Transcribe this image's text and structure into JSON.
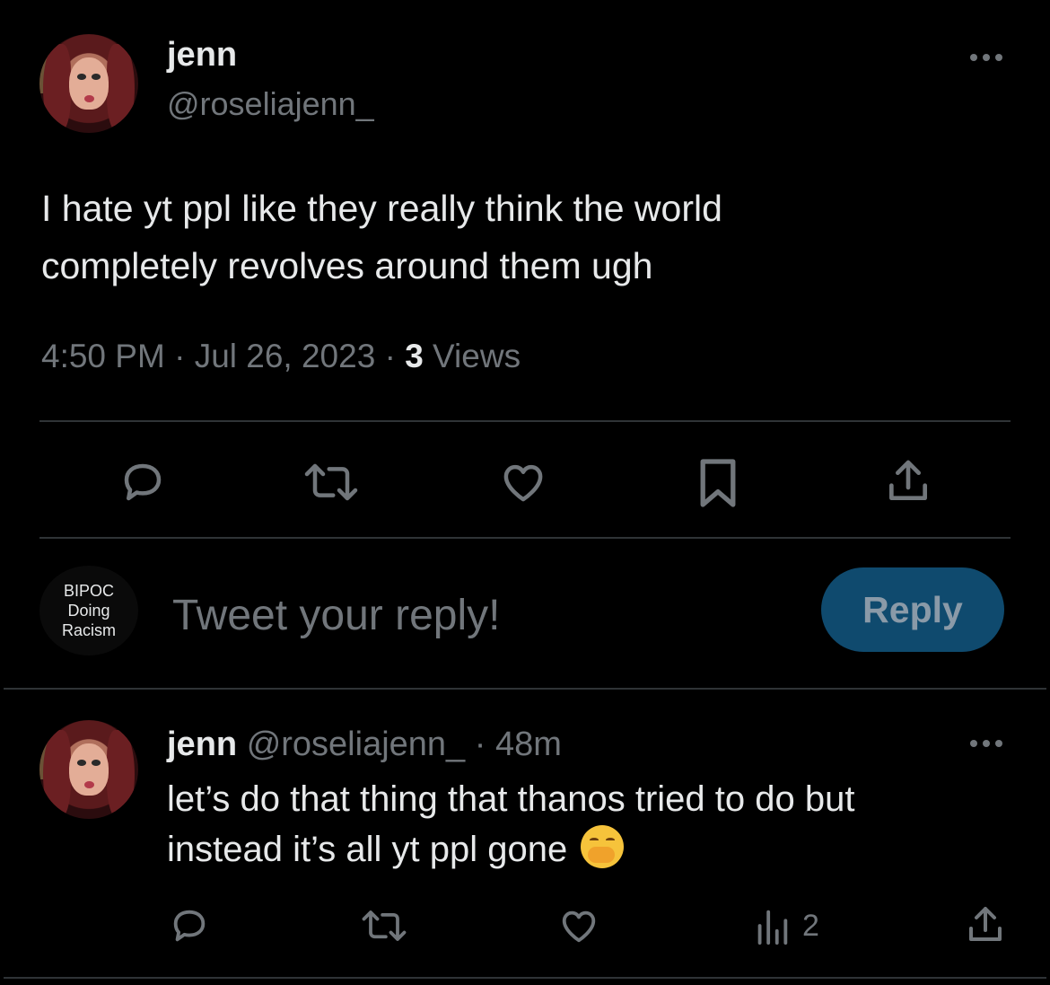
{
  "main_tweet": {
    "display_name": "jenn",
    "handle": "@roseliajenn_",
    "text_line1": "I hate yt ppl like they really think the world",
    "text_line2": "completely revolves around them ugh",
    "time": "4:50 PM",
    "sep1": " · ",
    "date": "Jul 26, 2023",
    "sep2": " · ",
    "views_count": "3",
    "views_label": " Views",
    "actions": [
      "reply-icon",
      "retweet-icon",
      "like-icon",
      "bookmark-icon",
      "share-icon"
    ]
  },
  "composer": {
    "avatar_line1": "BIPOC",
    "avatar_line2": "Doing",
    "avatar_line3": "Racism",
    "placeholder": "Tweet your reply!",
    "reply_label": "Reply"
  },
  "reply_tweet": {
    "display_name": "jenn",
    "handle": "@roseliajenn_",
    "dot": " · ",
    "age": "48m",
    "text_line1": "let’s do that thing that thanos tried to do but",
    "text_line2": "instead it’s all yt ppl gone",
    "emoji": "face-with-hand-over-mouth",
    "views_count": "2",
    "actions": [
      "reply-icon",
      "retweet-icon",
      "like-icon",
      "views-icon",
      "share-icon"
    ]
  },
  "colors": {
    "background": "#000000",
    "text": "#e7e9ea",
    "muted": "#71767b",
    "divider": "#2f3336",
    "reply_button_bg": "#0f4a6e",
    "reply_button_text": "#8a9aa8"
  }
}
